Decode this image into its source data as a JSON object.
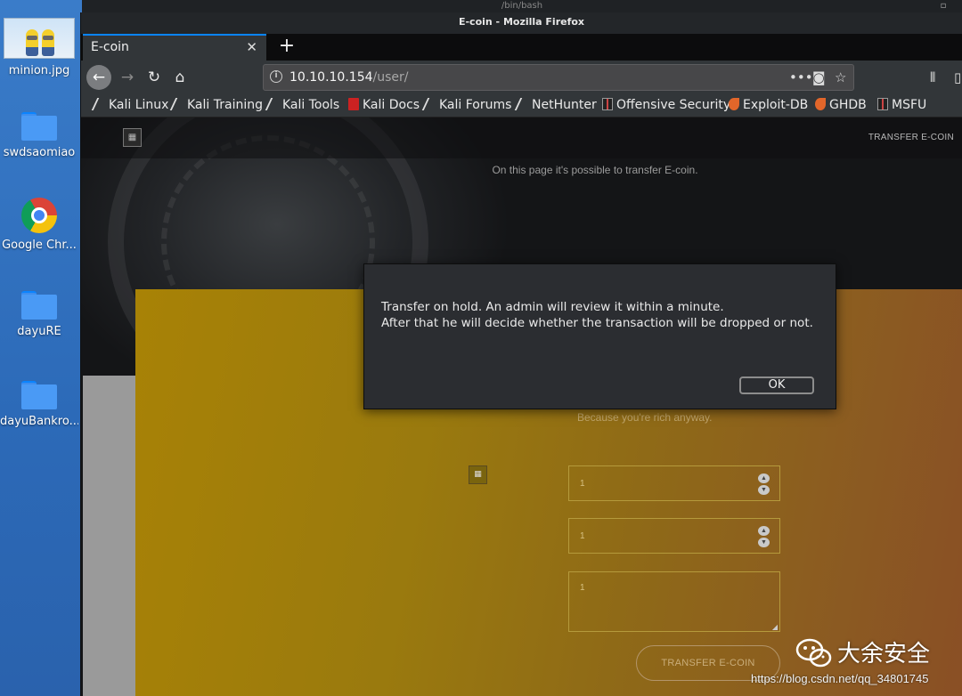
{
  "desktop": {
    "icons": [
      {
        "label": "minion.jpg",
        "type": "image"
      },
      {
        "label": "swdsaomiao",
        "type": "folder"
      },
      {
        "label": "Google Chr...",
        "type": "chrome"
      },
      {
        "label": "dayuRE",
        "type": "folder"
      },
      {
        "label": "dayuBankro...",
        "type": "folder"
      }
    ]
  },
  "terminal_title": "/bin/bash",
  "window": {
    "title": "E-coin - Mozilla Firefox",
    "tab_label": "E-coin",
    "url_host": "10.10.10.154",
    "url_path": "/user/"
  },
  "bookmarks": [
    {
      "label": "Kali Linux",
      "icon": "kali-dragon-icon"
    },
    {
      "label": "Kali Training",
      "icon": "kali-dragon-icon"
    },
    {
      "label": "Kali Tools",
      "icon": "kali-dragon-icon"
    },
    {
      "label": "Kali Docs",
      "icon": "kali-docs-icon"
    },
    {
      "label": "Kali Forums",
      "icon": "kali-dragon-icon"
    },
    {
      "label": "NetHunter",
      "icon": "kali-dragon-icon"
    },
    {
      "label": "Offensive Security",
      "icon": "offsec-icon"
    },
    {
      "label": "Exploit-DB",
      "icon": "exploitdb-icon"
    },
    {
      "label": "GHDB",
      "icon": "exploitdb-icon"
    },
    {
      "label": "MSFU",
      "icon": "offsec-icon"
    }
  ],
  "page": {
    "nav_link": "TRANSFER E-COIN",
    "subtitle": "On this page it's possible to transfer E-coin.",
    "rich_text": "Because you're rich anyway.",
    "field_amount": "1",
    "field_recipient": "1",
    "field_comment": "1",
    "submit_label": "TRANSFER E-COIN"
  },
  "dialog": {
    "line1": "Transfer on hold. An admin will review it within a minute.",
    "line2": "After that he will decide whether the transaction will be dropped or not.",
    "ok_label": "OK"
  },
  "watermark": {
    "brand": "大余安全",
    "url": "https://blog.csdn.net/qq_34801745"
  },
  "colors": {
    "accent_tab": "#0a84ff",
    "gold_panel": "#a88206",
    "dialog_bg": "#2b2d31"
  }
}
